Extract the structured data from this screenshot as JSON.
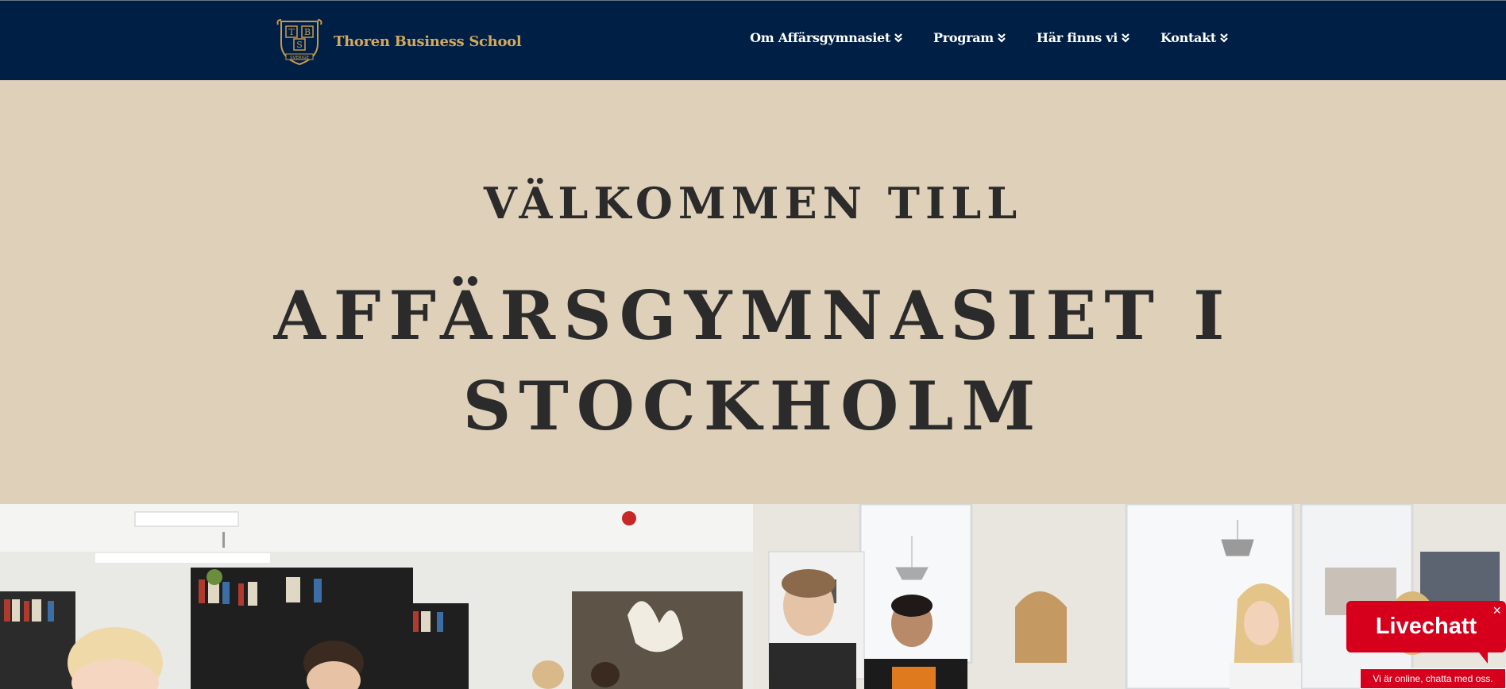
{
  "header": {
    "logo": {
      "crest_letters": [
        "T",
        "B",
        "S"
      ],
      "crest_banner": "SVERIGE",
      "brand_name": "Thoren Business School"
    },
    "nav": [
      {
        "label": "Om Affärsgymnasiet",
        "icon": "double-chevron-down-icon"
      },
      {
        "label": "Program",
        "icon": "double-chevron-down-icon"
      },
      {
        "label": "Här finns vi",
        "icon": "double-chevron-down-icon"
      },
      {
        "label": "Kontakt",
        "icon": "double-chevron-down-icon"
      }
    ]
  },
  "hero": {
    "subtitle": "VÄLKOMMEN TILL",
    "title_line1": "AFFÄRSGYMNASIET I",
    "title_line2": "STOCKHOLM"
  },
  "livechat": {
    "title": "Livechatt",
    "close": "×",
    "subtitle": "Vi är online, chatta med oss."
  },
  "colors": {
    "header_bg": "#001f45",
    "brand_gold": "#d4a85a",
    "hero_bg": "#dfd0b9",
    "hero_text": "#2b2b2b",
    "chat_red": "#d6001c"
  }
}
